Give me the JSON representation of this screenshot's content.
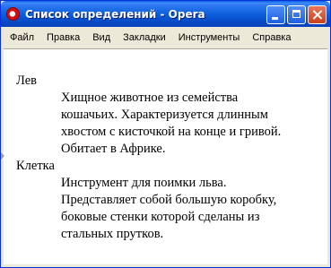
{
  "window": {
    "title": "Список определений - Opera",
    "app_icon": "opera-icon"
  },
  "controls": {
    "minimize": "minimize-icon",
    "maximize": "maximize-icon",
    "close": "close-icon"
  },
  "menu": [
    "Файл",
    "Правка",
    "Вид",
    "Закладки",
    "Инструменты",
    "Справка"
  ],
  "definitions": [
    {
      "term": "Лев",
      "lines": [
        "Хищное животное из семейства",
        "кошачьих. Характеризуется длинным",
        "хвостом с кисточкой на конце и гривой.",
        "Обитает в Африке."
      ]
    },
    {
      "term": "Клетка",
      "lines": [
        "Инструмент для поимки льва.",
        "Представляет собой большую коробку,",
        "боковые стенки которой сделаны из",
        "стальных прутков."
      ]
    }
  ],
  "colors": {
    "titlebar": "#0a5bd8",
    "close_button": "#c6421c",
    "window_frame": "#ece9d8"
  }
}
